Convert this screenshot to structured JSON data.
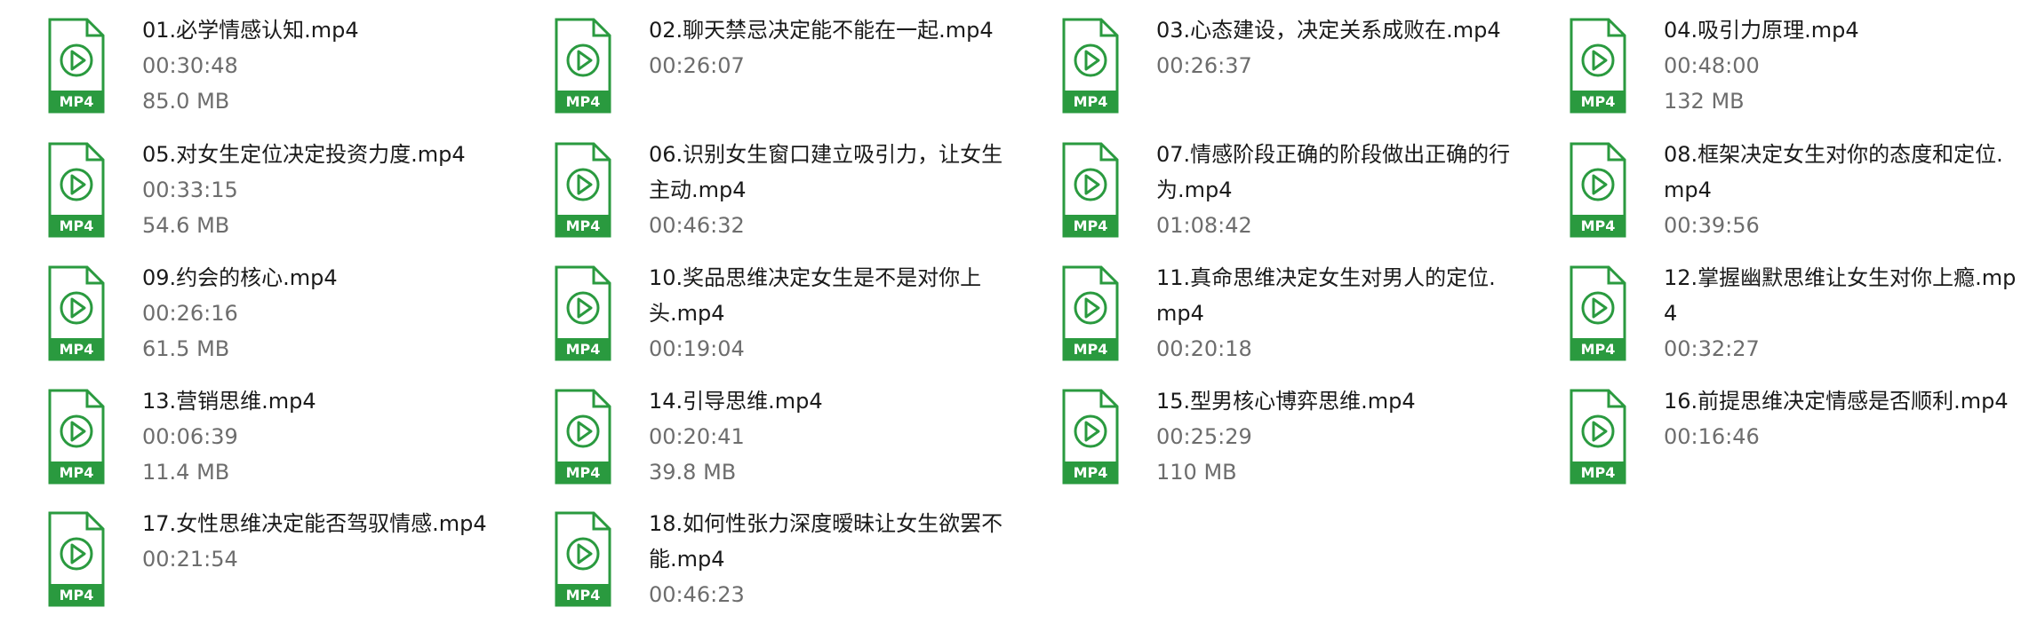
{
  "theme": {
    "icon_accent": "#2a9a3f",
    "text_color": "#1a1a1a",
    "meta_color": "#6d6d6d"
  },
  "icon_label": "MP4",
  "files": [
    {
      "name": "01.必学情感认知.mp4",
      "duration": "00:30:48",
      "size": "85.0 MB"
    },
    {
      "name": "02.聊天禁忌决定能不能在一起.mp4",
      "duration": "00:26:07",
      "size": ""
    },
    {
      "name": "03.心态建设，决定关系成败在.mp4",
      "duration": "00:26:37",
      "size": ""
    },
    {
      "name": "04.吸引力原理.mp4",
      "duration": "00:48:00",
      "size": "132 MB"
    },
    {
      "name": "05.对女生定位决定投资力度.mp4",
      "duration": "00:33:15",
      "size": "54.6 MB"
    },
    {
      "name": "06.识别女生窗口建立吸引力，让女生主动.mp4",
      "duration": "00:46:32",
      "size": ""
    },
    {
      "name": "07.情感阶段正确的阶段做出正确的行为.mp4",
      "duration": "01:08:42",
      "size": ""
    },
    {
      "name": "08.框架决定女生对你的态度和定位.mp4",
      "duration": "00:39:56",
      "size": ""
    },
    {
      "name": "09.约会的核心.mp4",
      "duration": "00:26:16",
      "size": "61.5 MB"
    },
    {
      "name": "10.奖品思维决定女生是不是对你上头.mp4",
      "duration": "00:19:04",
      "size": ""
    },
    {
      "name": "11.真命思维决定女生对男人的定位.mp4",
      "duration": "00:20:18",
      "size": ""
    },
    {
      "name": "12.掌握幽默思维让女生对你上瘾.mp4",
      "duration": "00:32:27",
      "size": ""
    },
    {
      "name": "13.营销思维.mp4",
      "duration": "00:06:39",
      "size": "11.4 MB"
    },
    {
      "name": "14.引导思维.mp4",
      "duration": "00:20:41",
      "size": "39.8 MB"
    },
    {
      "name": "15.型男核心博弈思维.mp4",
      "duration": "00:25:29",
      "size": "110 MB"
    },
    {
      "name": "16.前提思维决定情感是否顺利.mp4",
      "duration": "00:16:46",
      "size": ""
    },
    {
      "name": "17.女性思维决定能否驾驭情感.mp4",
      "duration": "00:21:54",
      "size": ""
    },
    {
      "name": "18.如何性张力深度暧昧让女生欲罢不能.mp4",
      "duration": "00:46:23",
      "size": ""
    }
  ]
}
